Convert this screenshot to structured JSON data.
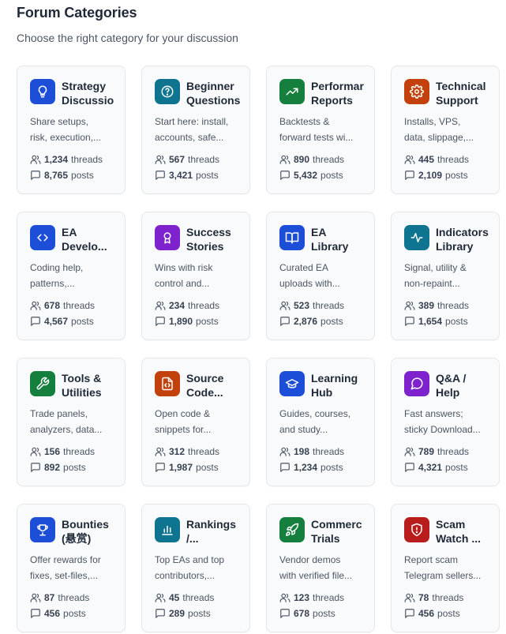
{
  "header": {
    "title": "Forum Categories",
    "subtitle": "Choose the right category for your discussion"
  },
  "colors": {
    "blue": "#1d4ed8",
    "teal": "#0e7490",
    "green": "#15803d",
    "orange": "#c2410c",
    "purple": "#7e22ce",
    "red": "#b91c1c"
  },
  "categories": [
    {
      "title1": "Strategy",
      "title2": "Discussio",
      "desc1": "Share setups,",
      "desc2": "risk, execution,...",
      "threads_count": "1,234",
      "threads_label": "threads",
      "posts_count": "8,765",
      "posts_label": "posts",
      "color": "#1d4ed8",
      "icon": "lightbulb-icon"
    },
    {
      "title1": "Beginner",
      "title2": "Questions",
      "desc1": "Start here: install,",
      "desc2": "accounts, safe...",
      "threads_count": "567",
      "threads_label": "threads",
      "posts_count": "3,421",
      "posts_label": "posts",
      "color": "#0e7490",
      "icon": "question-circle-icon"
    },
    {
      "title1": "Performar",
      "title2": "Reports",
      "desc1": "Backtests &",
      "desc2": "forward tests wi...",
      "threads_count": "890",
      "threads_label": "threads",
      "posts_count": "5,432",
      "posts_label": "posts",
      "color": "#15803d",
      "icon": "trending-up-icon"
    },
    {
      "title1": "Technical",
      "title2": "Support",
      "desc1": "Installs, VPS,",
      "desc2": "data, slippage,...",
      "threads_count": "445",
      "threads_label": "threads",
      "posts_count": "2,109",
      "posts_label": "posts",
      "color": "#c2410c",
      "icon": "gear-icon"
    },
    {
      "title1": "EA",
      "title2": "Develo...",
      "desc1": "Coding help,",
      "desc2": "patterns,...",
      "threads_count": "678",
      "threads_label": "threads",
      "posts_count": "4,567",
      "posts_label": "posts",
      "color": "#1d4ed8",
      "icon": "code-icon"
    },
    {
      "title1": "Success",
      "title2": "Stories",
      "desc1": "Wins with risk",
      "desc2": "control and...",
      "threads_count": "234",
      "threads_label": "threads",
      "posts_count": "1,890",
      "posts_label": "posts",
      "color": "#7e22ce",
      "icon": "award-icon"
    },
    {
      "title1": "EA",
      "title2": "Library",
      "desc1": "Curated EA",
      "desc2": "uploads with...",
      "threads_count": "523",
      "threads_label": "threads",
      "posts_count": "2,876",
      "posts_label": "posts",
      "color": "#1d4ed8",
      "icon": "book-icon"
    },
    {
      "title1": "Indicators",
      "title2": "Library",
      "desc1": "Signal, utility &",
      "desc2": "non-repaint...",
      "threads_count": "389",
      "threads_label": "threads",
      "posts_count": "1,654",
      "posts_label": "posts",
      "color": "#0e7490",
      "icon": "activity-icon"
    },
    {
      "title1": "Tools &",
      "title2": "Utilities",
      "desc1": "Trade panels,",
      "desc2": "analyzers, data...",
      "threads_count": "156",
      "threads_label": "threads",
      "posts_count": "892",
      "posts_label": "posts",
      "color": "#15803d",
      "icon": "wrench-icon"
    },
    {
      "title1": "Source",
      "title2": "Code...",
      "desc1": "Open code &",
      "desc2": "snippets for...",
      "threads_count": "312",
      "threads_label": "threads",
      "posts_count": "1,987",
      "posts_label": "posts",
      "color": "#c2410c",
      "icon": "file-code-icon"
    },
    {
      "title1": "Learning",
      "title2": "Hub",
      "desc1": "Guides, courses,",
      "desc2": "and study...",
      "threads_count": "198",
      "threads_label": "threads",
      "posts_count": "1,234",
      "posts_label": "posts",
      "color": "#1d4ed8",
      "icon": "graduation-cap-icon"
    },
    {
      "title1": "Q&A /",
      "title2": "Help",
      "desc1": "Fast answers;",
      "desc2": "sticky Download...",
      "threads_count": "789",
      "threads_label": "threads",
      "posts_count": "4,321",
      "posts_label": "posts",
      "color": "#7e22ce",
      "icon": "chat-bubble-icon"
    },
    {
      "title1": "Bounties",
      "title2": "(悬赏)",
      "desc1": "Offer rewards for",
      "desc2": "fixes, set-files,...",
      "threads_count": "87",
      "threads_label": "threads",
      "posts_count": "456",
      "posts_label": "posts",
      "color": "#1d4ed8",
      "icon": "trophy-icon"
    },
    {
      "title1": "Rankings",
      "title2": "/...",
      "desc1": "Top EAs and top",
      "desc2": "contributors,...",
      "threads_count": "45",
      "threads_label": "threads",
      "posts_count": "289",
      "posts_label": "posts",
      "color": "#0e7490",
      "icon": "bar-chart-icon"
    },
    {
      "title1": "Commerc",
      "title2": "Trials",
      "desc1": "Vendor demos",
      "desc2": "with verified file...",
      "threads_count": "123",
      "threads_label": "threads",
      "posts_count": "678",
      "posts_label": "posts",
      "color": "#15803d",
      "icon": "rocket-icon"
    },
    {
      "title1": "Scam",
      "title2": "Watch ...",
      "desc1": "Report scam",
      "desc2": "Telegram sellers...",
      "threads_count": "78",
      "threads_label": "threads",
      "posts_count": "456",
      "posts_label": "posts",
      "color": "#b91c1c",
      "icon": "shield-alert-icon"
    }
  ]
}
